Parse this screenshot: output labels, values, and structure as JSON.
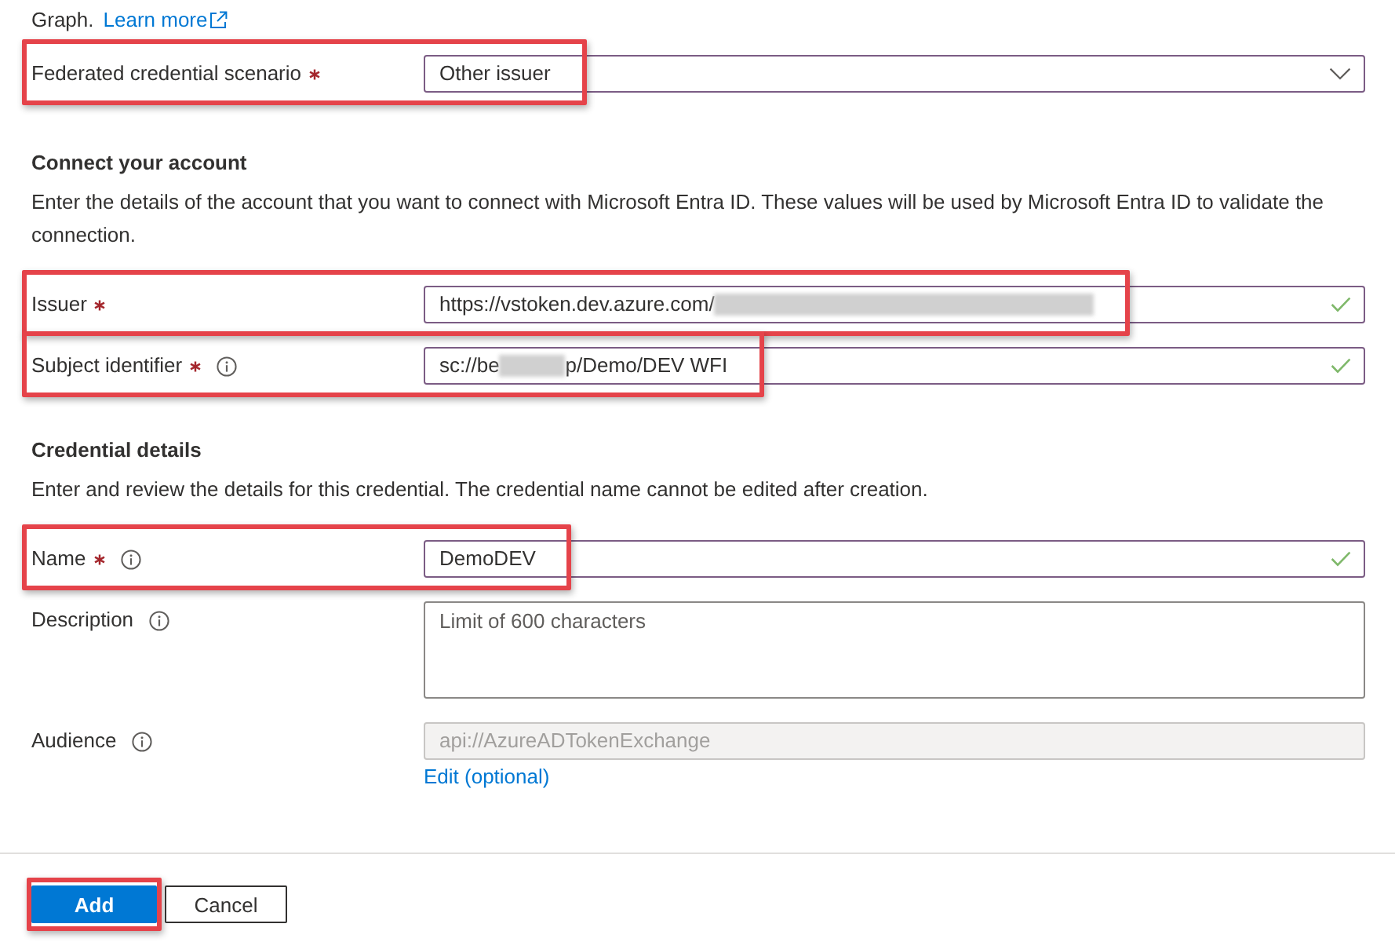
{
  "intro": {
    "text": "Graph.",
    "link": "Learn more"
  },
  "sections": [
    {
      "fields": [
        {
          "kind": "dropdown",
          "label": "Federated credential scenario",
          "required": true,
          "info": false,
          "parts": [
            {
              "kind": "text",
              "text": "Other issuer"
            }
          ],
          "valid": false,
          "highlighted": true
        }
      ]
    },
    {
      "heading": "Connect your account",
      "description": "Enter the details of the account that you want to connect with Microsoft Entra ID. These values will be used by Microsoft Entra ID to validate the connection.",
      "fields": [
        {
          "kind": "text",
          "label": "Issuer",
          "required": true,
          "info": false,
          "parts": [
            {
              "kind": "text",
              "text": "https://vstoken.dev.azure.com/"
            },
            {
              "kind": "redacted"
            }
          ],
          "valid": true,
          "highlighted": true
        },
        {
          "kind": "text",
          "label": "Subject identifier",
          "required": true,
          "info": true,
          "parts": [
            {
              "kind": "text",
              "text": "sc://be"
            },
            {
              "kind": "redacted"
            },
            {
              "kind": "text",
              "text": "p/Demo/DEV WFI"
            }
          ],
          "valid": true,
          "highlighted": true
        }
      ]
    },
    {
      "heading": "Credential details",
      "description": "Enter and review the details for this credential. The credential name cannot be edited after creation.",
      "fields": [
        {
          "kind": "text",
          "label": "Name",
          "required": true,
          "info": true,
          "parts": [
            {
              "kind": "text",
              "text": "DemoDEV"
            }
          ],
          "valid": true,
          "highlighted": true
        },
        {
          "kind": "textarea",
          "label": "Description",
          "required": false,
          "info": true,
          "placeholder": "Limit of 600 characters",
          "valid": false,
          "highlighted": false
        },
        {
          "kind": "readonly",
          "label": "Audience",
          "required": false,
          "info": true,
          "parts": [
            {
              "kind": "text",
              "text": "api://AzureADTokenExchange"
            }
          ],
          "valid": false,
          "highlighted": false,
          "link": "Edit (optional)"
        }
      ]
    }
  ],
  "buttons": [
    {
      "label": "Add",
      "kind": "primary",
      "highlighted": true
    },
    {
      "label": "Cancel",
      "kind": "secondary",
      "highlighted": false
    }
  ]
}
